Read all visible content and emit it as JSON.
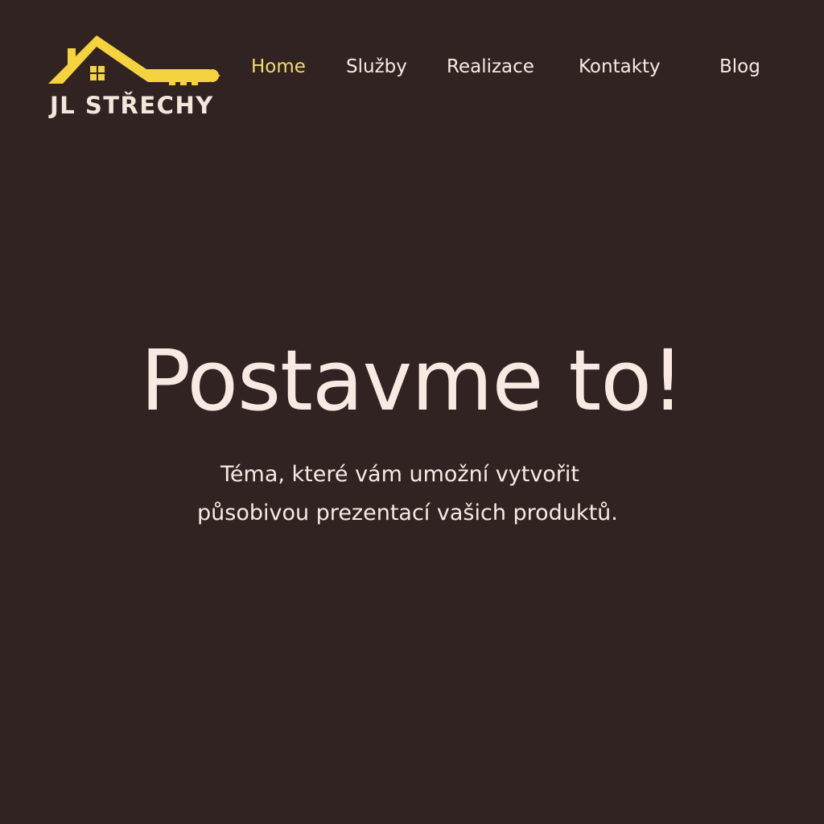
{
  "colors": {
    "background": "#312322",
    "accent": "#f1dc6f",
    "logo_yellow": "#f5d33f",
    "text": "#f3ebe4"
  },
  "logo": {
    "icon": "house-key-icon",
    "text": "JL STŘECHY"
  },
  "nav": {
    "items": [
      {
        "label": "Home",
        "active": true
      },
      {
        "label": "Služby",
        "active": false
      },
      {
        "label": "Realizace",
        "active": false
      },
      {
        "label": "Kontakty",
        "active": false
      },
      {
        "label": "Blog",
        "active": false
      }
    ]
  },
  "hero": {
    "title": "Postavme to!",
    "subtitle_line1": "Téma, které vám umožní vytvořit",
    "subtitle_line2": "působivou prezentací vašich produktů."
  }
}
